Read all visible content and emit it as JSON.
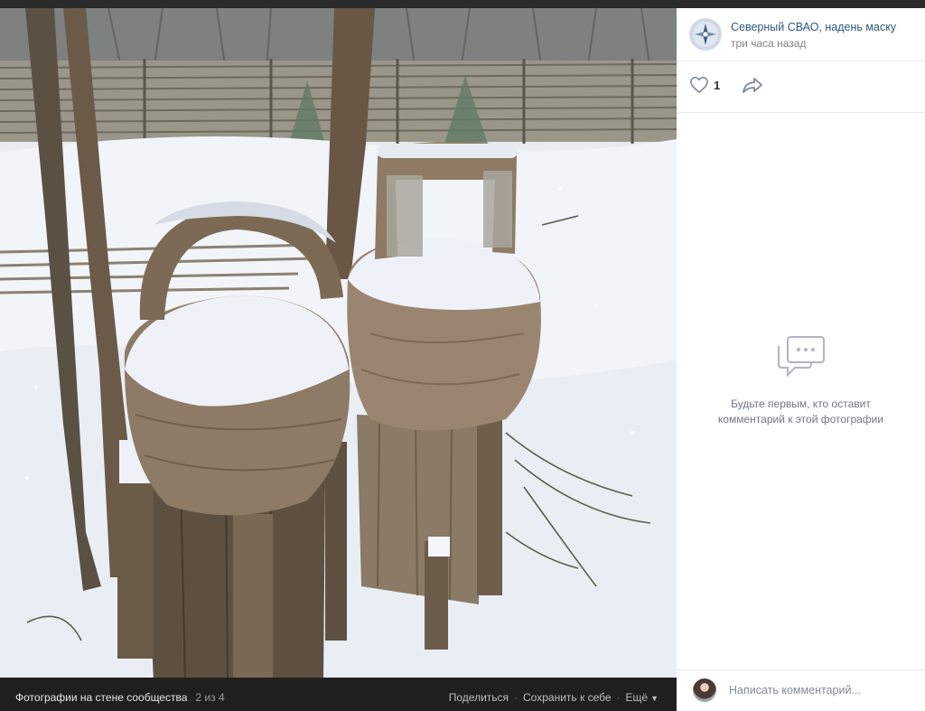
{
  "post": {
    "author": "Северный СВАО, надень маску",
    "time": "три часа назад",
    "likes": "1"
  },
  "comments": {
    "empty_line1": "Будьте первым, кто оставит",
    "empty_line2": "комментарий к этой фотографии",
    "placeholder": "Написать комментарий..."
  },
  "viewer": {
    "album_title": "Фотографии на стене сообщества",
    "counter": "2 из 4",
    "share_label": "Поделиться",
    "save_label": "Сохранить к себе",
    "more_label": "Ещё"
  },
  "icons": {
    "like": "heart-icon",
    "share": "share-arrow-icon",
    "empty_comments": "comment-bubble-icon",
    "more": "chevron-down-icon"
  },
  "colors": {
    "link": "#2a5885",
    "viewer_bar": "#1f1f1f",
    "muted_text": "#828282"
  }
}
